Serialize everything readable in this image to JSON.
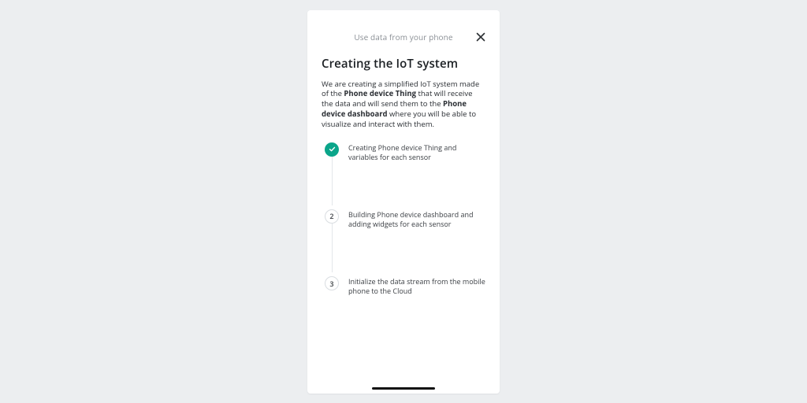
{
  "header": {
    "title": "Use data from your phone",
    "close_label": "Close"
  },
  "page": {
    "heading": "Creating the IoT system",
    "intro_parts": {
      "t1": "We are creating a simplified IoT system made of the ",
      "b1": "Phone device Thing",
      "t2": " that will receive the data and will send them to the ",
      "b2": "Phone device dashboard",
      "t3": " where you will be able to visualize and interact with them."
    }
  },
  "steps": [
    {
      "marker": "check",
      "text": "Creating Phone device Thing and variables for each sensor"
    },
    {
      "marker": "2",
      "text": "Building Phone device dashboard and adding widgets for each sensor"
    },
    {
      "marker": "3",
      "text": "Initialize the data stream from the mobile phone to the Cloud"
    }
  ]
}
